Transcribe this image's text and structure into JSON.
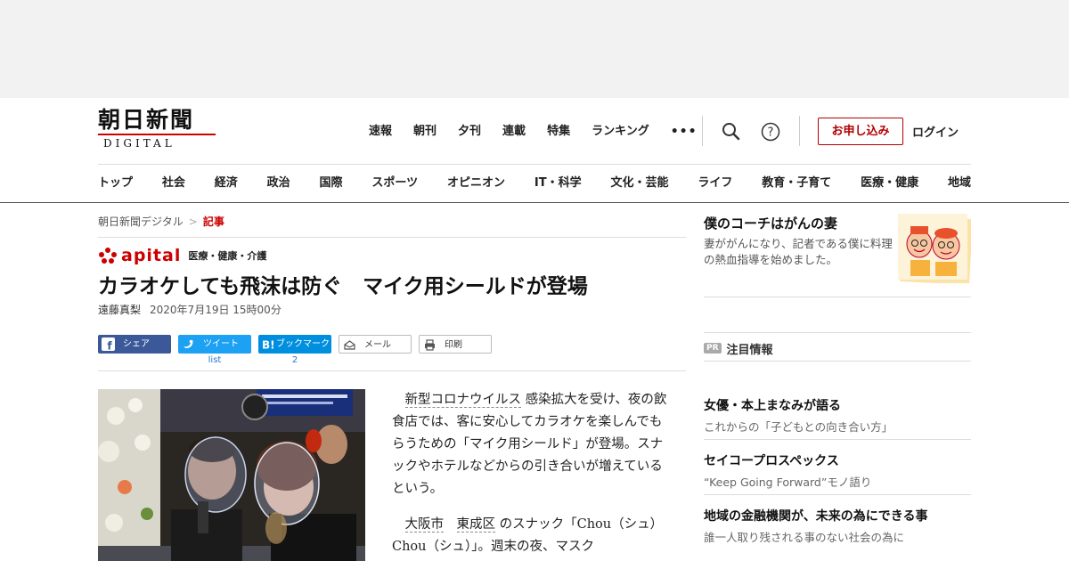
{
  "header": {
    "logo_jp": "朝日新聞",
    "logo_en": "DIGITAL",
    "top_nav": [
      "速報",
      "朝刊",
      "夕刊",
      "連載",
      "特集",
      "ランキング",
      "•••"
    ],
    "apply_label": "お申し込み",
    "login_label": "ログイン",
    "categories": [
      "トップ",
      "社会",
      "経済",
      "政治",
      "国際",
      "スポーツ",
      "オピニオン",
      "IT・科学",
      "文化・芸能",
      "ライフ",
      "教育・子育て",
      "医療・健康",
      "地域"
    ]
  },
  "breadcrumb": {
    "home": "朝日新聞デジタル",
    "sep": ">",
    "current": "記事"
  },
  "section": {
    "brand": "apital",
    "tag": "医療・健康・介護"
  },
  "article": {
    "headline": "カラオケしても飛沫は防ぐ　マイク用シールドが登場",
    "author": "遠藤真梨",
    "datetime": "2020年7月19日 15時00分",
    "share": {
      "facebook": "シェア",
      "twitter": "ツイート",
      "twitter_count": "list",
      "hatena": "ブックマーク",
      "hatena_count": "2",
      "mail": "メール",
      "print": "印刷"
    },
    "p1_kw": "新型コロナウイルス",
    "p1_rest": "感染拡大を受け、夜の飲食店では、客に安心してカラオケを楽しんでもらうための「マイク用シールド」が登場。スナックやホテルなどからの引き合いが増えているという。",
    "p2_kw1": "大阪市",
    "p2_mid": "　",
    "p2_kw2": "東成区",
    "p2_rest": "のスナック「Chou（シュ）　Chou（シュ）」。週末の夜、マスク"
  },
  "sidebar": {
    "promo": {
      "title": "僕のコーチはがんの妻",
      "desc": "妻ががんになり、記者である僕に料理の熱血指導を始めました。"
    },
    "featured_badge": "PR",
    "featured_label": "注目情報",
    "items": [
      {
        "title": "女優・本上まなみが語る",
        "desc": "これからの「子どもとの向き合い方」"
      },
      {
        "title": "セイコープロスペックス",
        "desc": "“Keep Going Forward”モノ語り"
      },
      {
        "title": "地域の金融機関が、未来の為にできる事",
        "desc": "誰一人取り残される事のない社会の為に"
      }
    ]
  },
  "colors": {
    "brand_red": "#c00000",
    "facebook": "#3b5998",
    "twitter": "#1da1f2",
    "hatena": "#008fde"
  },
  "icons": [
    "search-icon",
    "help-icon",
    "facebook-icon",
    "twitter-icon",
    "hatena-icon",
    "mail-icon",
    "print-icon"
  ]
}
